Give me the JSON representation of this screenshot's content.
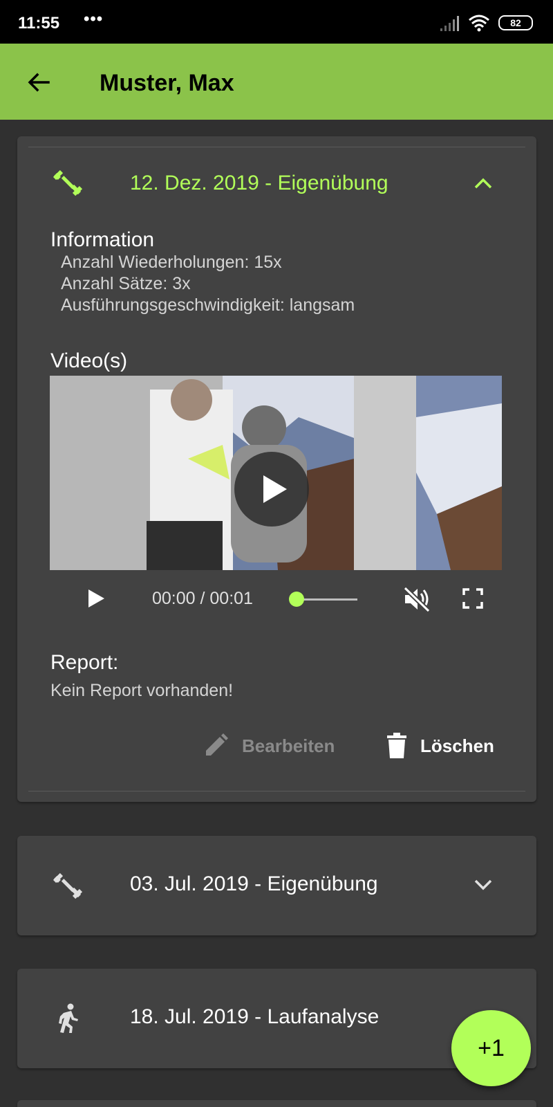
{
  "status_bar": {
    "time": "11:55",
    "dots": "•••",
    "battery": "82"
  },
  "app_bar": {
    "title": "Muster, Max",
    "back_icon": "arrow-left-icon"
  },
  "colors": {
    "accent": "#8bc34a",
    "highlight": "#b2ff59",
    "card": "#424242",
    "background": "#303030"
  },
  "entries": [
    {
      "title": "12. Dez. 2019 - Eigenübung",
      "icon": "dumbbell-icon",
      "expanded": true,
      "information_heading": "Information",
      "information": [
        "Anzahl Wiederholungen: 15x",
        "Anzahl Sätze: 3x",
        "Ausführungsgeschwindigkeit: langsam"
      ],
      "videos_heading": "Video(s)",
      "video": {
        "time": "00:00 / 00:01",
        "progress": 0,
        "muted": true
      },
      "report_heading": "Report:",
      "report_text": "Kein Report vorhanden!",
      "edit_label": "Bearbeiten",
      "delete_label": "Löschen"
    },
    {
      "title": "03. Jul. 2019 - Eigenübung",
      "icon": "dumbbell-icon",
      "expanded": false
    },
    {
      "title": "18. Jul. 2019 - Laufanalyse",
      "icon": "running-person-icon",
      "expanded": false
    }
  ],
  "fab": {
    "label": "+1"
  }
}
